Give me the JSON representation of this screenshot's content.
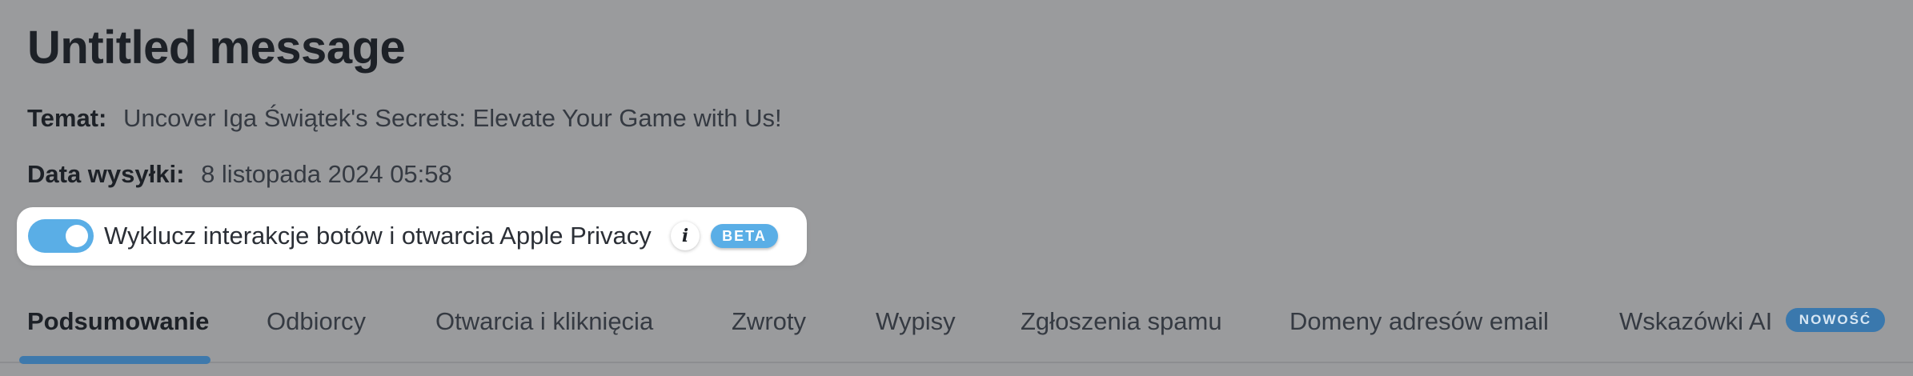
{
  "page": {
    "title": "Untitled message"
  },
  "meta": {
    "subject_label": "Temat:",
    "subject_value": "Uncover Iga Świątek's Secrets: Elevate Your Game with Us!",
    "date_label": "Data wysyłki:",
    "date_value": "8 listopada 2024 05:58"
  },
  "toggle": {
    "label": "Wyklucz interakcje botów i otwarcia Apple Privacy",
    "enabled": true,
    "info_icon": "info-icon",
    "badge": "BETA"
  },
  "tabs": {
    "items": [
      {
        "label": "Podsumowanie",
        "active": true
      },
      {
        "label": "Odbiorcy",
        "active": false
      },
      {
        "label": "Otwarcia i kliknięcia",
        "active": false
      },
      {
        "label": "Zwroty",
        "active": false
      },
      {
        "label": "Wypisy",
        "active": false
      },
      {
        "label": "Zgłoszenia spamu",
        "active": false
      },
      {
        "label": "Domeny adresów email",
        "active": false
      },
      {
        "label": "Wskazówki AI",
        "active": false
      }
    ],
    "new_badge": "NOWOŚĆ"
  },
  "colors": {
    "background": "#9a9b9d",
    "accent": "#5aaee6",
    "active_tab_underline": "#3e79ac",
    "new_badge": "#3a78ad"
  }
}
